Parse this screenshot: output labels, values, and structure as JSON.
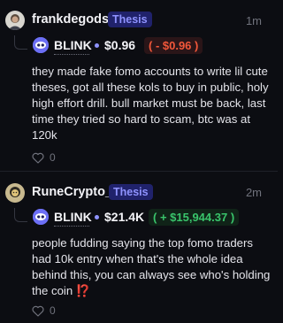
{
  "feed": {
    "posts": [
      {
        "username": "frankdegods",
        "badge": "Thesis",
        "time": "1m",
        "coin": {
          "ticker": "BLINK",
          "price": "$0.96",
          "change": "( - $0.96 )",
          "change_color": "#f2573a"
        },
        "text": "they made fake fomo accounts to write lil cute theses, got all these kols to buy in public, holy high effort drill. bull market must be back, last time they tried so hard to scam, btc was at 120k",
        "likes": "0"
      },
      {
        "username": "RuneCrypto_",
        "badge": "Thesis",
        "time": "2m",
        "coin": {
          "ticker": "BLINK",
          "price": "$21.4K",
          "change": "( + $15,944.37 )",
          "change_color": "#39c46b"
        },
        "text": "people fudding saying the top fomo traders had 10k entry when that's the whole idea behind this, you can always see who's holding the coin",
        "text_suffix": "⁉️",
        "likes": "0"
      }
    ]
  },
  "colors": {
    "accent": "#8f93ff",
    "badge_bg": "#20226b",
    "background": "#0c0d12"
  }
}
